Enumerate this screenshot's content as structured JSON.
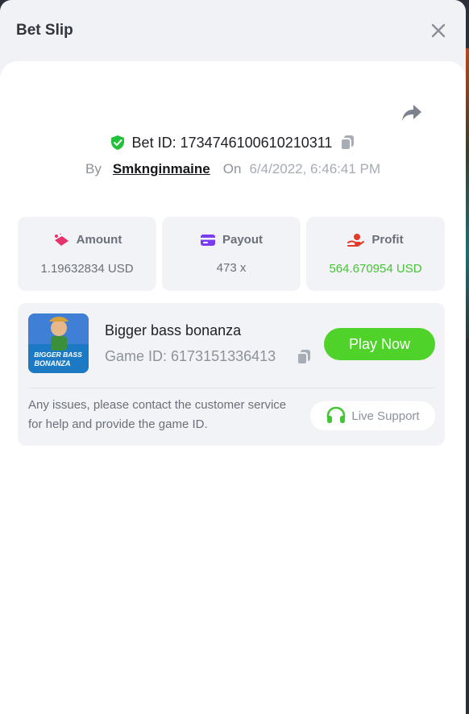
{
  "header": {
    "title": "Bet Slip"
  },
  "bet": {
    "id_text": "Bet ID: 1734746100610210311",
    "by_label": "By",
    "username": "Smknginmaine",
    "on_label": "On",
    "date": "6/4/2022, 6:46:41 PM"
  },
  "stats": {
    "amount": {
      "label": "Amount",
      "value": "1.19632834 USD"
    },
    "payout": {
      "label": "Payout",
      "value": "473 x"
    },
    "profit": {
      "label": "Profit",
      "value": "564.670954 USD"
    }
  },
  "game": {
    "name": "Bigger bass bonanza",
    "id_text": "Game ID: 6173151336413",
    "thumbnail_text_1": "BIGGER BASS",
    "thumbnail_text_2": "BONANZA",
    "play_label": "Play Now",
    "notice": "Any issues, please contact the customer service for help and provide the game ID.",
    "support_label": "Live Support"
  },
  "colors": {
    "accent_green": "#4fd229",
    "profit_green": "#45c435",
    "amount_icon": "#e6336b",
    "payout_icon": "#7a3cf0",
    "profit_icon": "#e23b2a",
    "shield_green": "#21c23a"
  }
}
